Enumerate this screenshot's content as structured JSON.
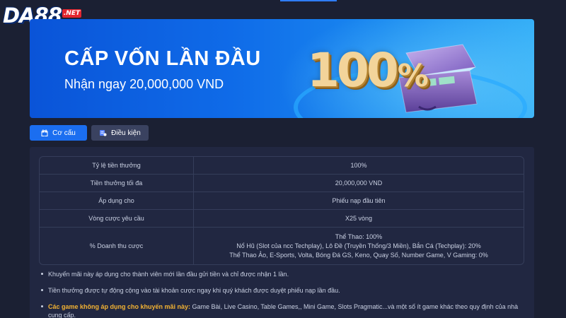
{
  "header": {
    "logo_main": "DA88",
    "logo_suffix": ".NET"
  },
  "banner": {
    "title": "CẤP VỐN LẦN ĐẦU",
    "subtitle": "Nhận ngay 20,000,000 VND",
    "percent_number": "100",
    "percent_sign": "%"
  },
  "tabs": [
    {
      "label": "Cơ cấu",
      "icon": "gift-icon",
      "active": true
    },
    {
      "label": "Điều kiện",
      "icon": "document-icon",
      "active": false
    }
  ],
  "table": {
    "rows": [
      {
        "label": "Tỷ lệ tiền thưởng",
        "value": [
          "100%"
        ]
      },
      {
        "label": "Tiền thưởng tối đa",
        "value": [
          "20,000,000 VND"
        ]
      },
      {
        "label": "Áp dụng cho",
        "value": [
          "Phiếu nạp đầu tiên"
        ]
      },
      {
        "label": "Vòng cược yêu cầu",
        "value": [
          "X25 vòng"
        ]
      },
      {
        "label": "% Doanh thu cược",
        "value": [
          "Thể Thao: 100%",
          "Nổ Hũ (Slot của ncc Techplay), Lô Đề (Truyền Thống/3 Miền), Bắn Cá (Techplay): 20%",
          "Thể Thao Ảo, E-Sports, Volta, Bóng Đá GS, Keno, Quay Số, Number Game, V Gaming: 0%"
        ]
      }
    ]
  },
  "notes": {
    "note1": "Khuyến mãi này áp dụng cho thành viên mới lần đầu gửi tiền và chỉ được nhận 1 lần.",
    "note2": "Tiền thưởng được tự động cộng vào tài khoản cược ngay khi quý khách được duyệt phiếu nạp lần đầu.",
    "note3_highlight": "Các game không áp dụng cho khuyến mãi này:",
    "note3_text": " Game Bài, Live Casino, Table Games,, Mini Game, Slots Pragmatic...và một số ít game khác theo quy định của nhà cung cấp."
  },
  "colors": {
    "background": "#1b2033",
    "accent_blue": "#1b6ef0",
    "highlight_orange": "#f2b233"
  }
}
